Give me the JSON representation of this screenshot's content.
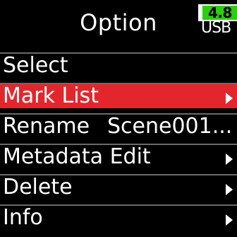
{
  "header": {
    "title": "Option",
    "battery_level": "4.8",
    "power_source": "USB"
  },
  "menu": {
    "items": [
      {
        "label": "Select",
        "value": "",
        "has_arrow": false,
        "selected": false
      },
      {
        "label": "Mark List",
        "value": "",
        "has_arrow": true,
        "selected": true
      },
      {
        "label": "Rename",
        "value": "Scene001...",
        "has_arrow": false,
        "selected": false
      },
      {
        "label": "Metadata Edit",
        "value": "",
        "has_arrow": true,
        "selected": false
      },
      {
        "label": "Delete",
        "value": "",
        "has_arrow": true,
        "selected": false
      },
      {
        "label": "Info",
        "value": "",
        "has_arrow": true,
        "selected": false
      }
    ]
  },
  "colors": {
    "background": "#000000",
    "highlight": "#e3262c",
    "battery": "#2ecc12",
    "divider": "#6a6a6a",
    "text": "#ffffff"
  }
}
